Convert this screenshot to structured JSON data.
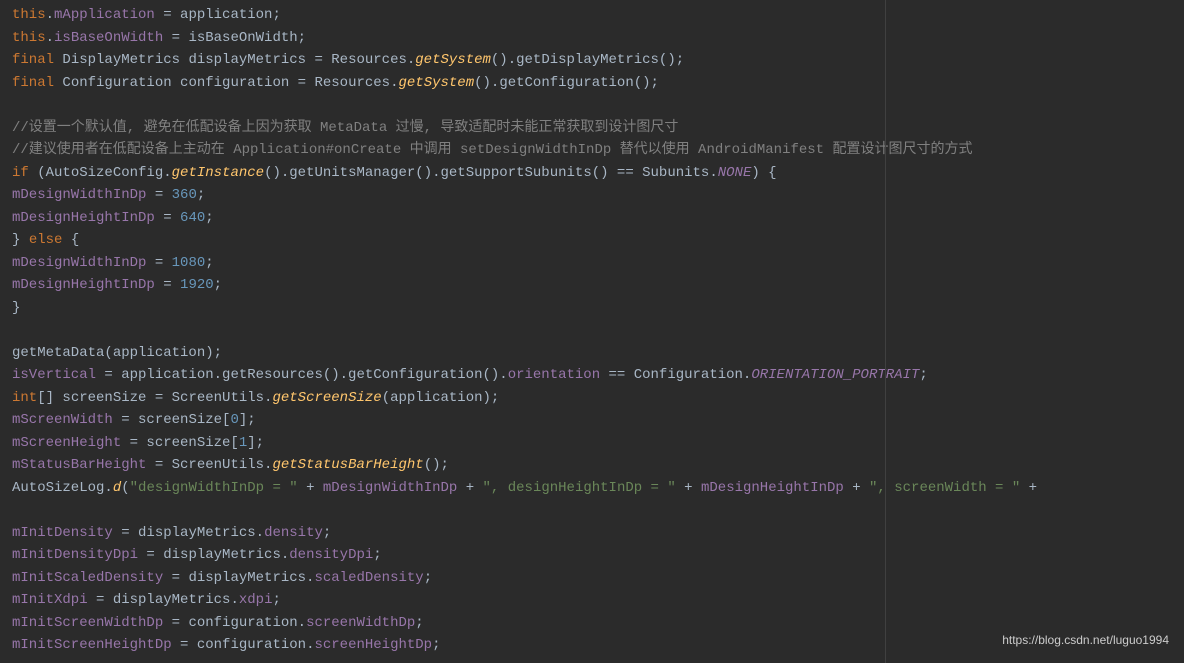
{
  "lines": {
    "l1": {
      "kw1": "this",
      "p1": ".",
      "f1": "mApplication",
      "p2": " = application;"
    },
    "l2": {
      "kw1": "this",
      "p1": ".",
      "f1": "isBaseOnWidth",
      "p2": " = isBaseOnWidth;"
    },
    "l3": {
      "kw1": "final",
      "p1": " DisplayMetrics displayMetrics = Resources.",
      "sm1": "getSystem",
      "p2": "().getDisplayMetrics();"
    },
    "l4": {
      "kw1": "final",
      "p1": " Configuration configuration = Resources.",
      "sm1": "getSystem",
      "p2": "().getConfiguration();"
    },
    "l5": {
      "c1": "//设置一个默认值, 避免在低配设备上因为获取 MetaData 过慢, 导致适配时未能正常获取到设计图尺寸"
    },
    "l6": {
      "c1": "//建议使用者在低配设备上主动在 Application#onCreate 中调用 setDesignWidthInDp 替代以使用 AndroidManifest 配置设计图尺寸的方式"
    },
    "l7": {
      "kw1": "if",
      "p1": " (AutoSizeConfig.",
      "sm1": "getInstance",
      "p2": "().getUnitsManager().getSupportSubunits() == Subunits.",
      "sf1": "NONE",
      "p3": ") {"
    },
    "l8": {
      "pad": "    ",
      "f1": "mDesignWidthInDp",
      "p1": " = ",
      "n1": "360",
      "p2": ";"
    },
    "l9": {
      "pad": "    ",
      "f1": "mDesignHeightInDp",
      "p1": " = ",
      "n1": "640",
      "p2": ";"
    },
    "l10": {
      "p1": "} ",
      "kw1": "else",
      "p2": " {"
    },
    "l11": {
      "pad": "    ",
      "f1": "mDesignWidthInDp",
      "p1": " = ",
      "n1": "1080",
      "p2": ";"
    },
    "l12": {
      "pad": "    ",
      "f1": "mDesignHeightInDp",
      "p1": " = ",
      "n1": "1920",
      "p2": ";"
    },
    "l13": {
      "p1": "}"
    },
    "l14": {
      "p1": "getMetaData(application);"
    },
    "l15": {
      "f1": "isVertical",
      "p1": " = application.getResources().getConfiguration().",
      "f2": "orientation",
      "p2": " == Configuration.",
      "sf1": "ORIENTATION_PORTRAIT",
      "p3": ";"
    },
    "l16": {
      "kw1": "int",
      "p1": "[] screenSize = ScreenUtils.",
      "sm1": "getScreenSize",
      "p2": "(application);"
    },
    "l17": {
      "f1": "mScreenWidth",
      "p1": " = screenSize[",
      "n1": "0",
      "p2": "];"
    },
    "l18": {
      "f1": "mScreenHeight",
      "p1": " = screenSize[",
      "n1": "1",
      "p2": "];"
    },
    "l19": {
      "f1": "mStatusBarHeight",
      "p1": " = ScreenUtils.",
      "sm1": "getStatusBarHeight",
      "p2": "();"
    },
    "l20": {
      "p1": "AutoSizeLog.",
      "sm1": "d",
      "p2": "(",
      "s1": "\"designWidthInDp = \"",
      "p3": " + ",
      "f1": "mDesignWidthInDp",
      "p4": " + ",
      "s2": "\", designHeightInDp = \"",
      "p5": " + ",
      "f2": "mDesignHeightInDp",
      "p6": " + ",
      "s3": "\", screenWidth = \"",
      "p7": " + "
    },
    "l21": {
      "f1": "mInitDensity",
      "p1": " = displayMetrics.",
      "f2": "density",
      "p2": ";"
    },
    "l22": {
      "f1": "mInitDensityDpi",
      "p1": " = displayMetrics.",
      "f2": "densityDpi",
      "p2": ";"
    },
    "l23": {
      "f1": "mInitScaledDensity",
      "p1": " = displayMetrics.",
      "f2": "scaledDensity",
      "p2": ";"
    },
    "l24": {
      "f1": "mInitXdpi",
      "p1": " = displayMetrics.",
      "f2": "xdpi",
      "p2": ";"
    },
    "l25": {
      "f1": "mInitScreenWidthDp",
      "p1": " = configuration.",
      "f2": "screenWidthDp",
      "p2": ";"
    },
    "l26": {
      "f1": "mInitScreenHeightDp",
      "p1": " = configuration.",
      "f2": "screenHeightDp",
      "p2": ";"
    }
  },
  "watermark": "https://blog.csdn.net/luguo1994"
}
